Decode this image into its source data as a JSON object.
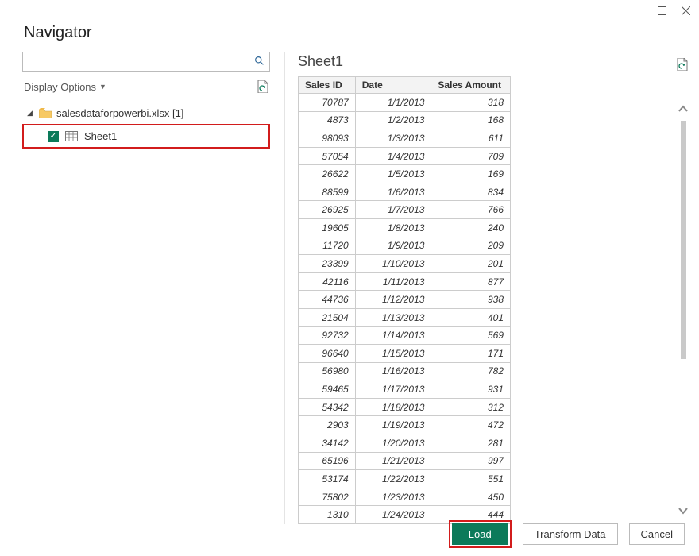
{
  "window": {
    "title": "Navigator"
  },
  "search": {
    "placeholder": ""
  },
  "options": {
    "label": "Display Options"
  },
  "tree": {
    "file_label": "salesdataforpowerbi.xlsx [1]",
    "sheet_label": "Sheet1"
  },
  "preview": {
    "title": "Sheet1",
    "columns": [
      "Sales ID",
      "Date",
      "Sales Amount"
    ],
    "rows": [
      [
        "70787",
        "1/1/2013",
        "318"
      ],
      [
        "4873",
        "1/2/2013",
        "168"
      ],
      [
        "98093",
        "1/3/2013",
        "611"
      ],
      [
        "57054",
        "1/4/2013",
        "709"
      ],
      [
        "26622",
        "1/5/2013",
        "169"
      ],
      [
        "88599",
        "1/6/2013",
        "834"
      ],
      [
        "26925",
        "1/7/2013",
        "766"
      ],
      [
        "19605",
        "1/8/2013",
        "240"
      ],
      [
        "11720",
        "1/9/2013",
        "209"
      ],
      [
        "23399",
        "1/10/2013",
        "201"
      ],
      [
        "42116",
        "1/11/2013",
        "877"
      ],
      [
        "44736",
        "1/12/2013",
        "938"
      ],
      [
        "21504",
        "1/13/2013",
        "401"
      ],
      [
        "92732",
        "1/14/2013",
        "569"
      ],
      [
        "96640",
        "1/15/2013",
        "171"
      ],
      [
        "56980",
        "1/16/2013",
        "782"
      ],
      [
        "59465",
        "1/17/2013",
        "931"
      ],
      [
        "54342",
        "1/18/2013",
        "312"
      ],
      [
        "2903",
        "1/19/2013",
        "472"
      ],
      [
        "34142",
        "1/20/2013",
        "281"
      ],
      [
        "65196",
        "1/21/2013",
        "997"
      ],
      [
        "53174",
        "1/22/2013",
        "551"
      ],
      [
        "75802",
        "1/23/2013",
        "450"
      ],
      [
        "1310",
        "1/24/2013",
        "444"
      ]
    ]
  },
  "footer": {
    "load": "Load",
    "transform": "Transform Data",
    "cancel": "Cancel"
  }
}
